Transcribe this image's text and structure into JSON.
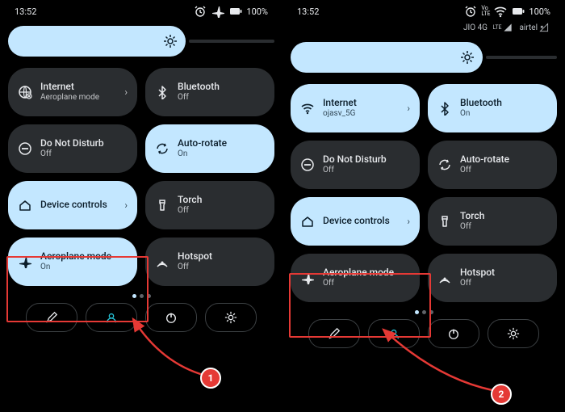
{
  "left": {
    "time": "13:52",
    "battery": "100%",
    "brightness_width": 220,
    "tiles": [
      {
        "icon": "globe",
        "title": "Internet",
        "sub": "Aeroplane mode",
        "style": "dark",
        "chev": true
      },
      {
        "icon": "bluetooth",
        "title": "Bluetooth",
        "sub": "Off",
        "style": "dark"
      },
      {
        "icon": "dnd",
        "title": "Do Not Disturb",
        "sub": "Off",
        "style": "dark"
      },
      {
        "icon": "rotate",
        "title": "Auto-rotate",
        "sub": "On",
        "style": "light"
      },
      {
        "icon": "home",
        "title": "Device controls",
        "sub": "",
        "style": "light",
        "chev": true
      },
      {
        "icon": "torch",
        "title": "Torch",
        "sub": "Off",
        "style": "dark"
      },
      {
        "icon": "plane",
        "title": "Aeroplane mode",
        "sub": "On",
        "style": "light"
      },
      {
        "icon": "hotspot",
        "title": "Hotspot",
        "sub": "Off",
        "style": "dark"
      }
    ],
    "badge": "1"
  },
  "right": {
    "time": "13:52",
    "battery": "100%",
    "carrier1": "JIO 4G",
    "carrier1_sub": "LTE",
    "carrier2": "airtel",
    "brightness_width": 238,
    "tiles": [
      {
        "icon": "wifi",
        "title": "Internet",
        "sub": "ojasv_5G",
        "style": "light",
        "chev": true
      },
      {
        "icon": "bluetooth",
        "title": "Bluetooth",
        "sub": "On",
        "style": "light"
      },
      {
        "icon": "dnd",
        "title": "Do Not Disturb",
        "sub": "Off",
        "style": "dark"
      },
      {
        "icon": "rotate",
        "title": "Auto-rotate",
        "sub": "Off",
        "style": "dark"
      },
      {
        "icon": "home",
        "title": "Device controls",
        "sub": "",
        "style": "light",
        "chev": true
      },
      {
        "icon": "torch",
        "title": "Torch",
        "sub": "Off",
        "style": "dark"
      },
      {
        "icon": "plane",
        "title": "Aeroplane mode",
        "sub": "Off",
        "style": "dark"
      },
      {
        "icon": "hotspot",
        "title": "Hotspot",
        "sub": "Off",
        "style": "dark"
      }
    ],
    "badge": "2"
  }
}
